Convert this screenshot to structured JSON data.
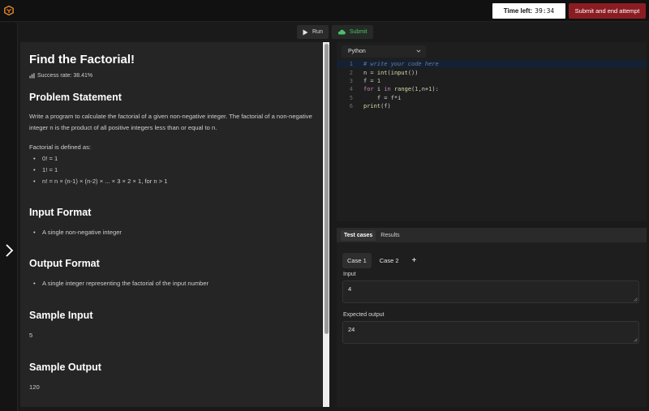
{
  "header": {
    "timer_label": "Time left:",
    "timer_value": "39:34",
    "end_button": "Submit and end attempt",
    "accent_color": "#8b1d22"
  },
  "toolbar": {
    "run_label": "Run",
    "submit_label": "Submit"
  },
  "problem": {
    "title": "Find the Factorial!",
    "success_rate": "Success rate: 38.41%",
    "statement_heading": "Problem Statement",
    "statement_text": "Write a program to calculate the factorial of a given non-negative integer. The factorial of a non-negative integer n is the product of all positive integers less than or equal to n.",
    "defined_as": "Factorial is defined as:",
    "definitions": [
      "0! = 1",
      "1! = 1",
      "n! = n × (n-1) × (n-2) × ... × 3 × 2 × 1, for n > 1"
    ],
    "input_heading": "Input Format",
    "input_items": [
      "A single non-negative integer"
    ],
    "output_heading": "Output Format",
    "output_items": [
      "A single integer representing the factorial of the input number"
    ],
    "sample_input_heading": "Sample Input",
    "sample_input": "5",
    "sample_output_heading": "Sample Output",
    "sample_output": "120"
  },
  "editor": {
    "language": "Python",
    "lines": [
      {
        "n": "1",
        "code": "# write your code here"
      },
      {
        "n": "2",
        "code": "n = int(input())"
      },
      {
        "n": "3",
        "code": "f = 1"
      },
      {
        "n": "4",
        "code": "for i in range(1,n+1):"
      },
      {
        "n": "5",
        "code": "    f = f*i"
      },
      {
        "n": "6",
        "code": "print(f)"
      }
    ]
  },
  "tests": {
    "tabs": [
      "Test cases",
      "Results"
    ],
    "cases": [
      "Case 1",
      "Case 2"
    ],
    "input_label": "Input",
    "input_value": "4",
    "expected_label": "Expected output",
    "expected_value": "24"
  }
}
